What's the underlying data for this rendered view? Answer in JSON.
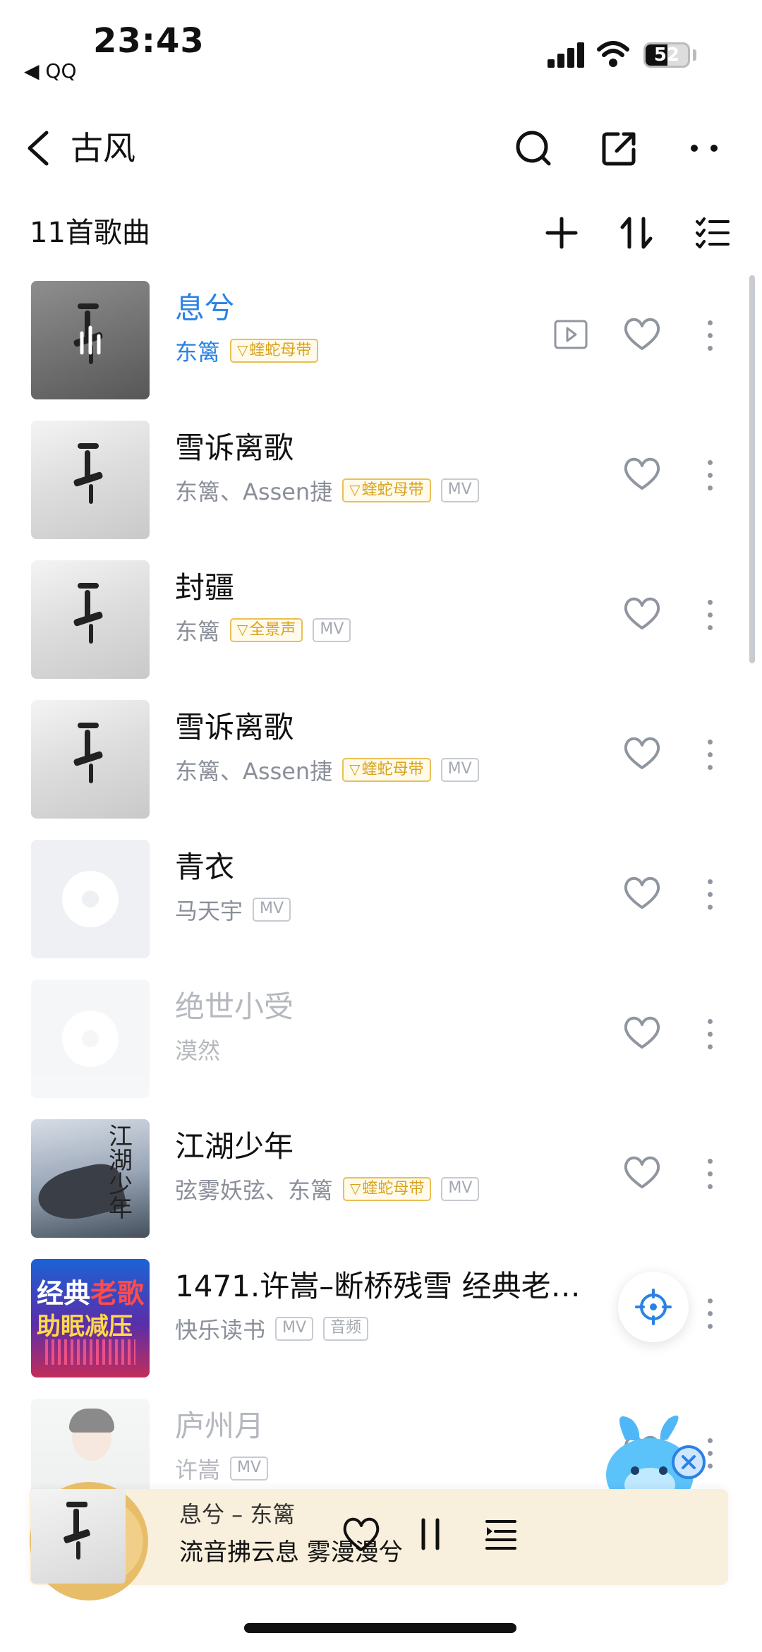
{
  "status_bar": {
    "time": "23:43",
    "back_app": "◀ QQ",
    "battery": "52",
    "battery_level": 0.52
  },
  "nav": {
    "title": "古风"
  },
  "list_header": {
    "count": "11首歌曲"
  },
  "songs": [
    {
      "title": "息兮",
      "artist": "东篱",
      "badges": [
        "蝰蛇母带"
      ],
      "mv": false,
      "cover": "album-dark",
      "active": true,
      "dim": false,
      "mv_play": true
    },
    {
      "title": "雪诉离歌",
      "artist": "东篱、Assen捷",
      "badges": [
        "蝰蛇母带"
      ],
      "mv": true,
      "cover": "album",
      "active": false,
      "dim": false
    },
    {
      "title": "封疆",
      "artist": "东篱",
      "badges": [
        "全景声"
      ],
      "mv": true,
      "cover": "album",
      "active": false,
      "dim": false
    },
    {
      "title": "雪诉离歌",
      "artist": "东篱、Assen捷",
      "badges": [
        "蝰蛇母带"
      ],
      "mv": true,
      "cover": "album",
      "active": false,
      "dim": false
    },
    {
      "title": "青衣",
      "artist": "马天宇",
      "badges": [],
      "mv": true,
      "cover": "blank",
      "active": false,
      "dim": false
    },
    {
      "title": "绝世小受",
      "artist": "漠然",
      "badges": [],
      "mv": false,
      "cover": "blank",
      "active": false,
      "dim": true
    },
    {
      "title": "江湖少年",
      "artist": "弦雾妖弦、东篱",
      "badges": [
        "蝰蛇母带"
      ],
      "mv": true,
      "cover": "jianghu",
      "active": false,
      "dim": false
    },
    {
      "title": "1471.许嵩–断桥残雪 经典老…",
      "artist": "快乐读书",
      "badges": [],
      "mv": true,
      "extra": "音频",
      "cover": "classic",
      "active": false,
      "dim": false
    },
    {
      "title": "庐州月",
      "artist": "许嵩",
      "badges": [],
      "mv": true,
      "cover": "person",
      "active": false,
      "dim": true
    }
  ],
  "labels": {
    "mv": "MV"
  },
  "covers": {
    "jianghu_text": "江湖少年",
    "classic_line1_a": "经典",
    "classic_line1_b": "老歌",
    "classic_line2": "助眠减压"
  },
  "player": {
    "song": "息兮 – 东篱",
    "lyric": "流音拂云息 雾漫漫兮"
  },
  "colors": {
    "accent": "#2a82e4",
    "gold": "#d9a21b",
    "player_bg": "#f8efdc"
  },
  "icons": [
    "back-icon",
    "search-icon",
    "share-icon",
    "more-icon",
    "add-icon",
    "sort-icon",
    "multi-select-icon",
    "heart-icon",
    "locate-icon",
    "pause-icon",
    "playlist-icon"
  ]
}
